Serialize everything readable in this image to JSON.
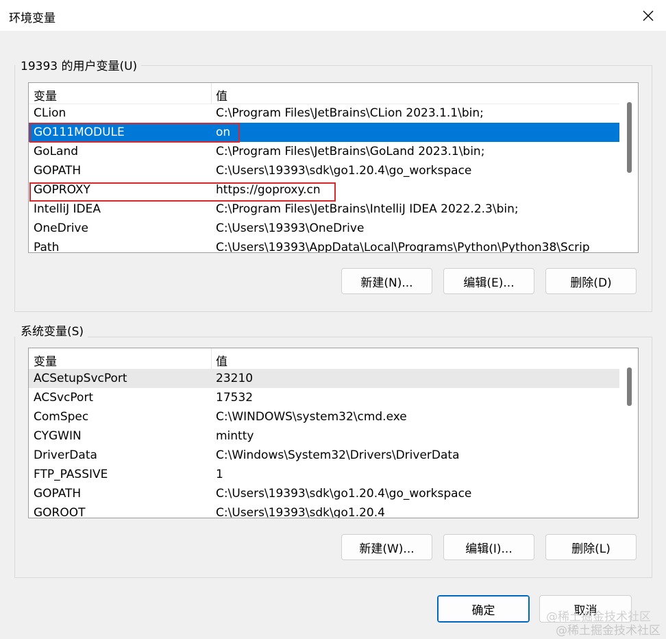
{
  "window": {
    "title": "环境变量"
  },
  "user_vars": {
    "group_label": "19393 的用户变量(U)",
    "header": {
      "name": "变量",
      "value": "值"
    },
    "rows": [
      {
        "name": "CLion",
        "value": "C:\\Program Files\\JetBrains\\CLion 2023.1.1\\bin;"
      },
      {
        "name": "GO111MODULE",
        "value": "on"
      },
      {
        "name": "GoLand",
        "value": "C:\\Program Files\\JetBrains\\GoLand 2023.1\\bin;"
      },
      {
        "name": "GOPATH",
        "value": "C:\\Users\\19393\\sdk\\go1.20.4\\go_workspace"
      },
      {
        "name": "GOPROXY",
        "value": "https://goproxy.cn"
      },
      {
        "name": "IntelliJ IDEA",
        "value": "C:\\Program Files\\JetBrains\\IntelliJ IDEA 2022.2.3\\bin;"
      },
      {
        "name": "OneDrive",
        "value": "C:\\Users\\19393\\OneDrive"
      },
      {
        "name": "Path",
        "value": "C:\\Users\\19393\\AppData\\Local\\Programs\\Python\\Python38\\Scrip"
      }
    ],
    "buttons": {
      "new": "新建(N)...",
      "edit": "编辑(E)...",
      "delete": "删除(D)"
    }
  },
  "system_vars": {
    "group_label": "系统变量(S)",
    "header": {
      "name": "变量",
      "value": "值"
    },
    "rows": [
      {
        "name": "ACSetupSvcPort",
        "value": "23210"
      },
      {
        "name": "ACSvcPort",
        "value": "17532"
      },
      {
        "name": "ComSpec",
        "value": "C:\\WINDOWS\\system32\\cmd.exe"
      },
      {
        "name": "CYGWIN",
        "value": "mintty"
      },
      {
        "name": "DriverData",
        "value": "C:\\Windows\\System32\\Drivers\\DriverData"
      },
      {
        "name": "FTP_PASSIVE",
        "value": "1"
      },
      {
        "name": "GOPATH",
        "value": "C:\\Users\\19393\\sdk\\go1.20.4\\go_workspace"
      },
      {
        "name": "GOROOT",
        "value": "C:\\Users\\19393\\sdk\\go1.20.4"
      }
    ],
    "buttons": {
      "new": "新建(W)...",
      "edit": "编辑(I)...",
      "delete": "删除(L)"
    }
  },
  "footer": {
    "ok": "确定",
    "cancel": "取消"
  },
  "watermark": "@稀土掘金技术社区",
  "colors": {
    "selection": "#0078d7",
    "highlight_box": "#d9282d",
    "primary_border": "#0067c0"
  }
}
